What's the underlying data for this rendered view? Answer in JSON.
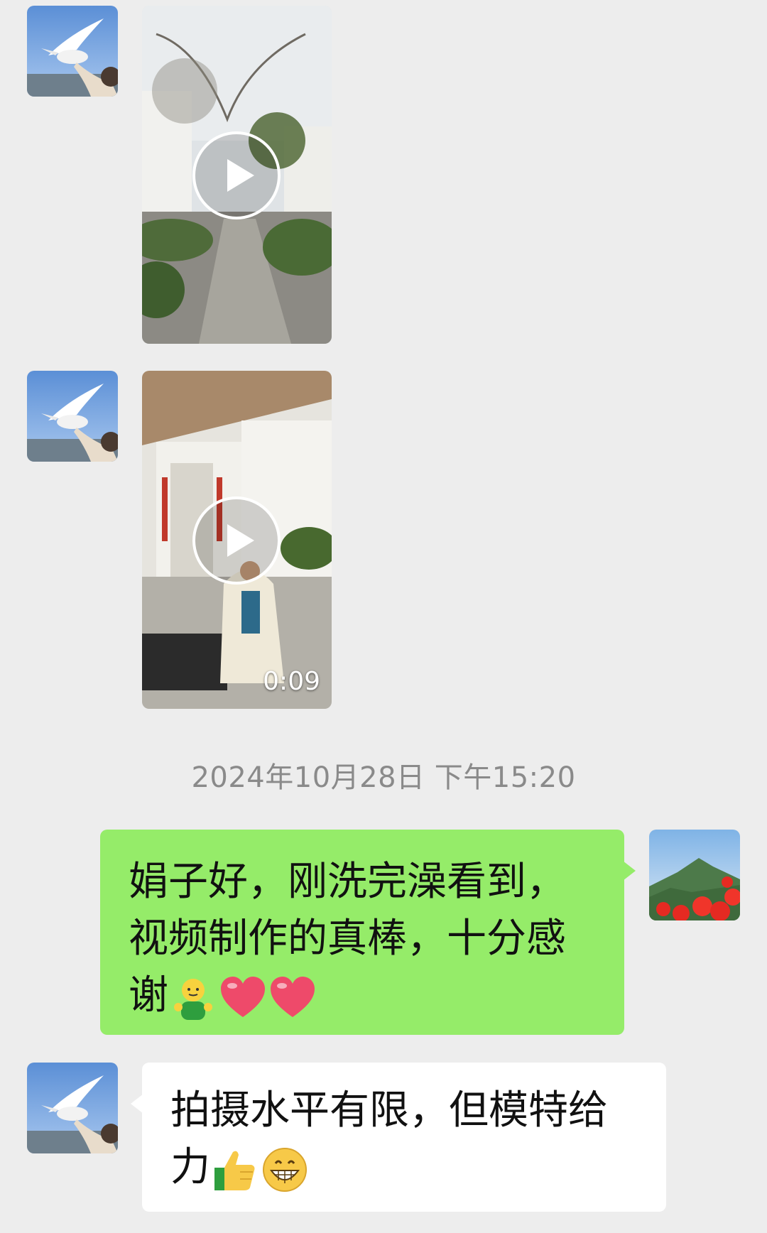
{
  "conversation": {
    "messages": [
      {
        "sender": "contact",
        "type": "video",
        "avatar": "seagull-hand-avatar",
        "duration": ""
      },
      {
        "sender": "contact",
        "type": "video",
        "avatar": "seagull-hand-avatar",
        "duration": "0:09"
      },
      {
        "type": "timestamp",
        "text": "2024年10月28日 下午15:20"
      },
      {
        "sender": "me",
        "type": "text",
        "avatar": "mountain-flowers-avatar",
        "text": "娟子好，刚洗完澡看到，视频制作的真棒，十分感谢",
        "emojis": [
          "smiling-person-emoji",
          "heart-emoji",
          "heart-emoji"
        ]
      },
      {
        "sender": "contact",
        "type": "text",
        "avatar": "seagull-hand-avatar",
        "text": "拍摄水平有限，但模特给力",
        "emojis": [
          "thumbs-up-emoji",
          "grinning-face-emoji"
        ]
      }
    ]
  },
  "colors": {
    "background": "#EDEDED",
    "sent_bubble": "#95EC69",
    "received_bubble": "#FFFFFF",
    "timestamp_text": "#8A8A8A"
  }
}
